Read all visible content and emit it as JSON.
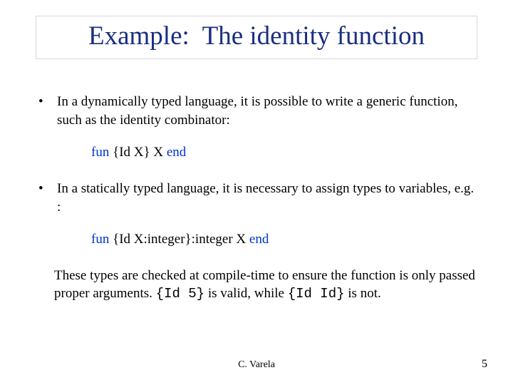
{
  "title": "Example:  The identity function",
  "bullets": [
    "In a dynamically typed language, it is possible to write a generic function, such as the identity combinator:",
    "In a statically typed language, it is necessary to assign types to variables, e.g. :"
  ],
  "code1": {
    "kw_fun": "fun",
    "mid": " {Id X} X ",
    "kw_end": "end"
  },
  "code2": {
    "kw_fun": "fun",
    "mid": " {Id X:integer}:integer X ",
    "kw_end": "end"
  },
  "para": {
    "pre": "These types are checked at compile-time to ensure the function is only passed proper arguments. ",
    "m1": "{Id 5}",
    "mid": " is valid, while ",
    "m2": "{Id Id}",
    "post": " is not."
  },
  "footer": {
    "author": "C. Varela",
    "page": "5"
  }
}
